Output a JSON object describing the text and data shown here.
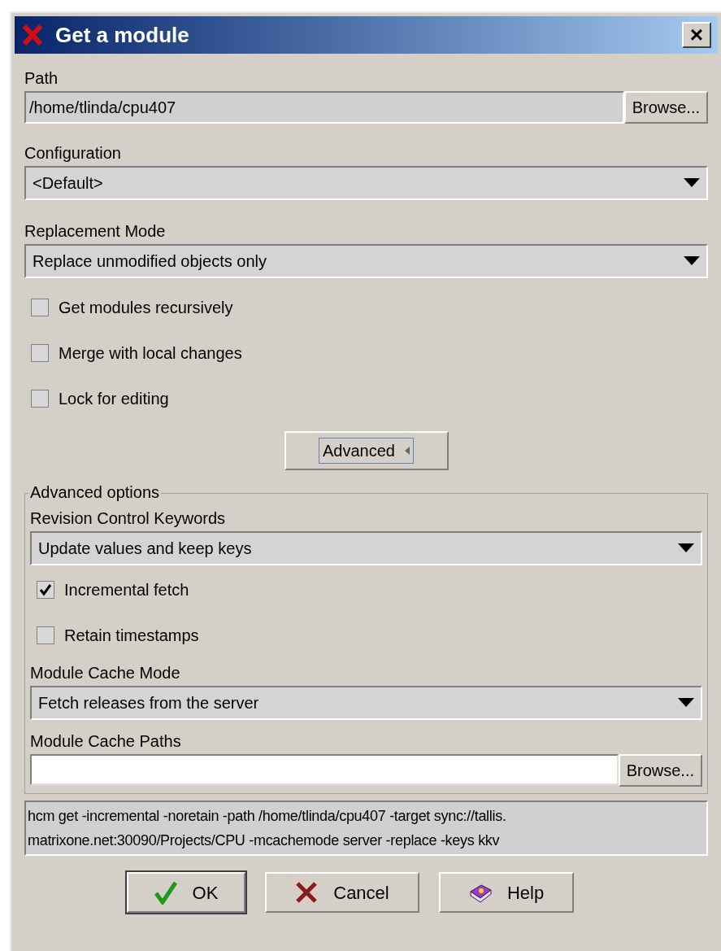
{
  "window": {
    "title": "Get a module",
    "close": "×"
  },
  "path": {
    "label": "Path",
    "value": "/home/tlinda/cpu407",
    "browse": "Browse..."
  },
  "configuration": {
    "label": "Configuration",
    "value": "<Default>"
  },
  "replacement_mode": {
    "label": "Replacement Mode",
    "value": "Replace unmodified objects only"
  },
  "options": [
    {
      "label": "Get modules recursively",
      "checked": false
    },
    {
      "label": "Merge with local changes",
      "checked": false
    },
    {
      "label": "Lock for editing",
      "checked": false
    }
  ],
  "advanced_button": {
    "label": "Advanced",
    "expanded": true
  },
  "advanced_options": {
    "title": "Advanced options",
    "keywords": {
      "label": "Revision Control Keywords",
      "value": "Update values and keep keys"
    },
    "options": [
      {
        "label": "Incremental fetch",
        "checked": true
      },
      {
        "label": "Retain timestamps",
        "checked": false
      }
    ],
    "cache_mode": {
      "label": "Module Cache Mode",
      "value": "Fetch releases from the server"
    },
    "cache_paths": {
      "label": "Module Cache Paths",
      "browse": "Browse..."
    }
  },
  "command_lines": [
    "hcm get -incremental -noretain -path /home/tlinda/cpu407 -target sync://tallis.",
    "matrixone.net:30090/Projects/CPU -mcachemode server -replace -keys kkv"
  ],
  "buttons": [
    {
      "label": "OK",
      "kind": "ok"
    },
    {
      "label": "Cancel",
      "kind": "cancel"
    },
    {
      "label": "Help",
      "kind": "help"
    }
  ]
}
